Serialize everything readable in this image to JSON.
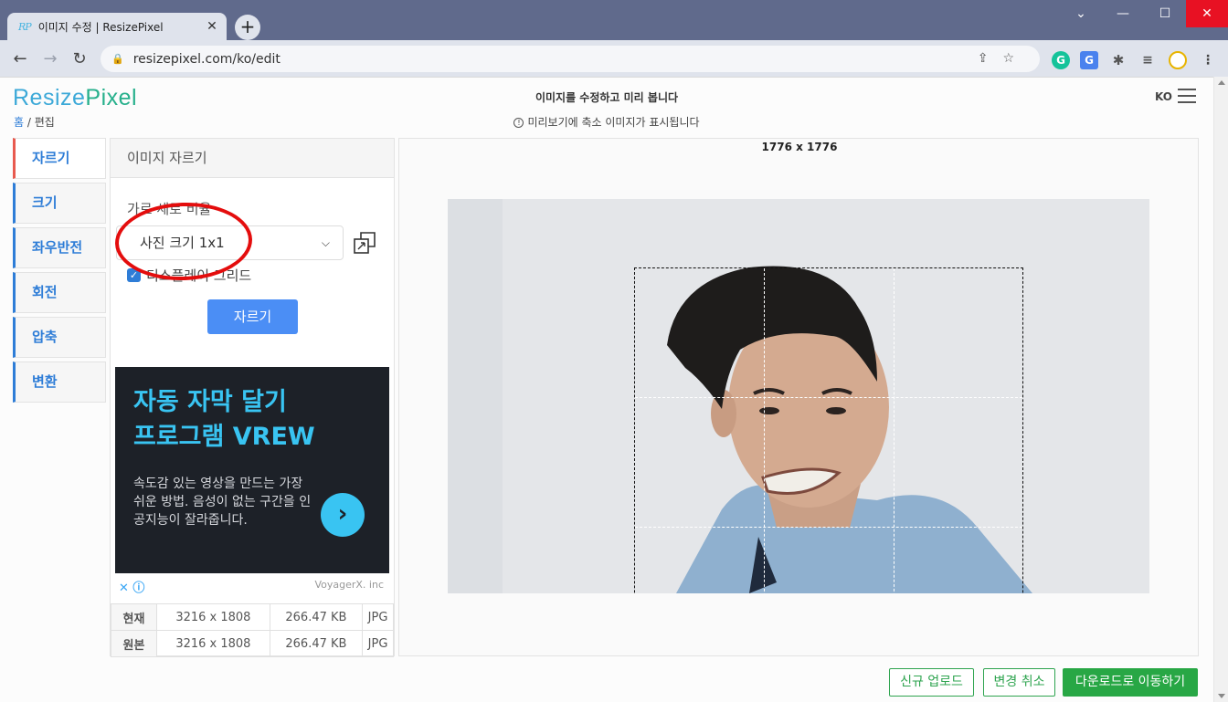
{
  "browser": {
    "tab_favicon": "RP",
    "tab_title": "이미지 수정 | ResizePixel",
    "url": "resizepixel.com/ko/edit"
  },
  "header": {
    "logo_part1": "Resize",
    "logo_part2": "Pixel",
    "breadcrumb_home": "홈",
    "breadcrumb_current": "편집",
    "title": "이미지를 수정하고 미리 봅니다",
    "note": "미리보기에 축소 이미지가 표시됩니다",
    "lang": "KO"
  },
  "sidebar": {
    "items": [
      {
        "label": "자르기"
      },
      {
        "label": "크기"
      },
      {
        "label": "좌우반전"
      },
      {
        "label": "회전"
      },
      {
        "label": "압축"
      },
      {
        "label": "변환"
      }
    ]
  },
  "panel": {
    "title": "이미지 자르기",
    "ratio_label": "가로 세로 비율",
    "ratio_value": "사진 크기 1x1",
    "grid_label": "디스플레이 그리드",
    "crop_button": "자르기"
  },
  "ad": {
    "headline1": "자동 자막 달기",
    "headline2": "프로그램 VREW",
    "body": "속도감 있는 영상을 만드는 가장 쉬운 방법. 음성이 없는 구간을 인공지능이 잘라줍니다.",
    "sponsor": "VoyagerX. inc"
  },
  "info": {
    "rows": [
      {
        "label": "현재",
        "dims": "3216 x 1808",
        "size": "266.47 KB",
        "format": "JPG"
      },
      {
        "label": "원본",
        "dims": "3216 x 1808",
        "size": "266.47 KB",
        "format": "JPG"
      }
    ]
  },
  "preview": {
    "dims": "1776 x 1776"
  },
  "buttons": {
    "new_upload": "신규 업로드",
    "cancel_changes": "변경 취소",
    "go_download": "다운로드로 이동하기"
  },
  "colors": {
    "accent": "#4b8ef5",
    "green": "#28a745",
    "annotation_red": "#e40d0d"
  }
}
